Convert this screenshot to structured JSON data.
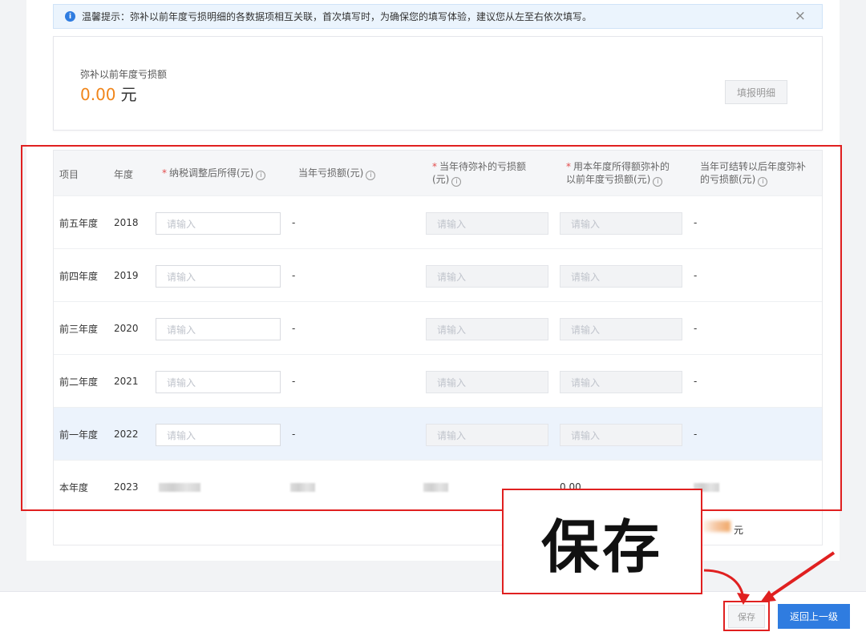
{
  "notice": {
    "text": "温馨提示：弥补以前年度亏损明细的各数据项相互关联，首次填写时，为确保您的填写体验，建议您从左至右依次填写。",
    "close": "×",
    "icon": "info-icon"
  },
  "summary": {
    "label": "弥补以前年度亏损额",
    "value": "0.00",
    "unit": "元",
    "detail_button": "填报明细"
  },
  "table": {
    "headers": {
      "item": "项目",
      "year": "年度",
      "taxable_income": "纳税调整后所得(元)",
      "current_loss": "当年亏损额(元)",
      "pending_loss_line1": "当年待弥补的亏损额",
      "pending_loss_line2": "(元)",
      "offset_line1": "用本年度所得额弥补的",
      "offset_line2": "以前年度亏损额(元)",
      "carry_line1": "当年可结转以后年度弥补",
      "carry_line2": "的亏损额(元)",
      "required_mark": "*",
      "help_icon": "i"
    },
    "rows": [
      {
        "item": "前五年度",
        "year": "2018",
        "placeholder": "请输入",
        "current_loss": "-",
        "carry": "-"
      },
      {
        "item": "前四年度",
        "year": "2019",
        "placeholder": "请输入",
        "current_loss": "-",
        "carry": "-"
      },
      {
        "item": "前三年度",
        "year": "2020",
        "placeholder": "请输入",
        "current_loss": "-",
        "carry": "-"
      },
      {
        "item": "前二年度",
        "year": "2021",
        "placeholder": "请输入",
        "current_loss": "-",
        "carry": "-"
      },
      {
        "item": "前一年度",
        "year": "2022",
        "placeholder": "请输入",
        "current_loss": "-",
        "carry": "-"
      }
    ],
    "current_row": {
      "item": "本年度",
      "year": "2023",
      "offset": "0.00"
    }
  },
  "total": {
    "unit": "元"
  },
  "callout": {
    "text": "保存"
  },
  "footer": {
    "save_label": "保存",
    "back_label": "返回上一级"
  },
  "colors": {
    "accent": "#2f7ce0",
    "annotation_red": "#e02020",
    "amount_orange": "#f0851a"
  }
}
